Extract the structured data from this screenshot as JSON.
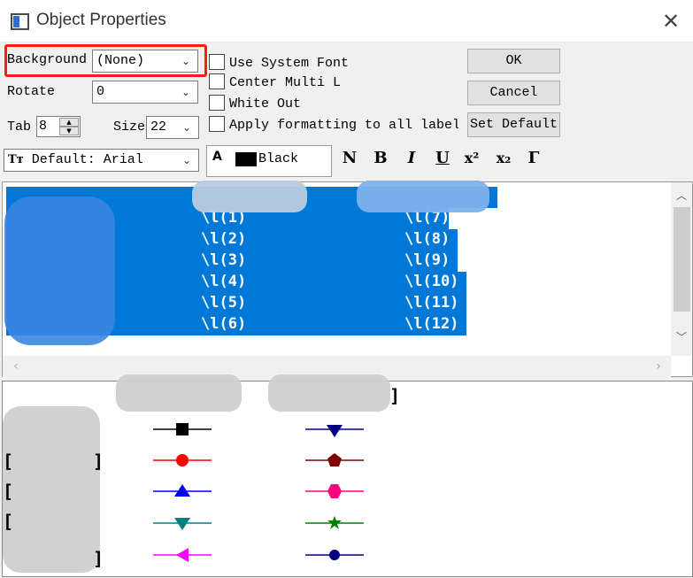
{
  "window": {
    "title": "Object Properties"
  },
  "controls": {
    "background_label": "Background",
    "background_value": "(None)",
    "rotate_label": "Rotate",
    "rotate_value": "0",
    "tab_label": "Tab",
    "tab_value": "8",
    "size_label": "Size",
    "size_value": "22",
    "font_value": "Default: Arial",
    "color_value": "Black"
  },
  "checkboxes": [
    {
      "label": "Use System Font",
      "checked": false
    },
    {
      "label": "Center Multi L",
      "checked": false
    },
    {
      "label": "White Out",
      "checked": false
    },
    {
      "label": "Apply formatting to all label",
      "checked": false
    }
  ],
  "buttons": {
    "ok": "OK",
    "cancel": "Cancel",
    "set_default": "Set Default"
  },
  "format_buttons": [
    "N",
    "B",
    "I",
    "U",
    "x²",
    "x₂",
    "Γ"
  ],
  "editor": {
    "col1": [
      "\\l(1)",
      "\\l(2)",
      "\\l(3)",
      "\\l(4)",
      "\\l(5)",
      "\\l(6)"
    ],
    "col2": [
      "\\l(7)",
      "\\l(8)",
      "\\l(9)",
      "\\l(10)",
      "\\l(11)",
      "\\l(12)"
    ],
    "selection_color": "#0078d7"
  },
  "legend_symbols": {
    "col1": [
      {
        "shape": "square",
        "color": "#000000"
      },
      {
        "shape": "circle",
        "color": "#ff0000"
      },
      {
        "shape": "triangle-up",
        "color": "#0000ff"
      },
      {
        "shape": "triangle-down",
        "color": "#008080"
      },
      {
        "shape": "triangle-left",
        "color": "#ff00ff"
      }
    ],
    "col2": [
      {
        "shape": "triangle-down",
        "color": "#000080"
      },
      {
        "shape": "pentagon",
        "color": "#800000"
      },
      {
        "shape": "hexagon",
        "color": "#ff0080"
      },
      {
        "shape": "star",
        "color": "#008000"
      },
      {
        "shape": "circle",
        "color": "#000080"
      }
    ]
  }
}
